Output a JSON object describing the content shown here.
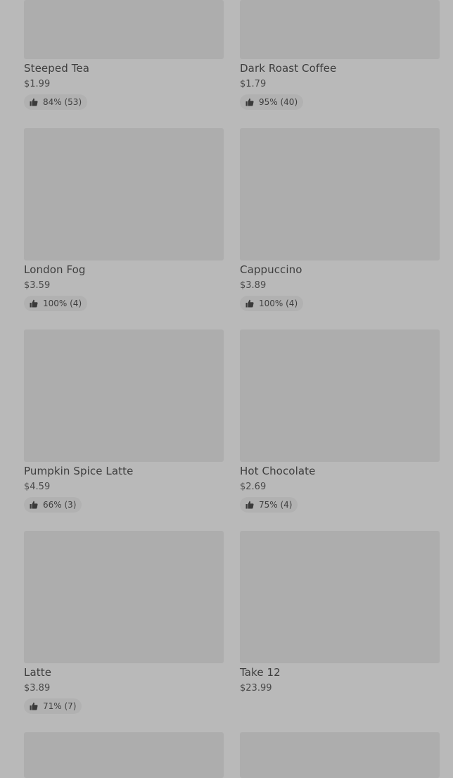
{
  "products": [
    {
      "name": "Steeped Tea",
      "price": "$1.99",
      "rating": "84% (53)"
    },
    {
      "name": "Dark Roast Coffee",
      "price": "$1.79",
      "rating": "95% (40)"
    },
    {
      "name": "London Fog",
      "price": "$3.59",
      "rating": "100% (4)"
    },
    {
      "name": "Cappuccino",
      "price": "$3.89",
      "rating": "100% (4)"
    },
    {
      "name": "Pumpkin Spice Latte",
      "price": "$4.59",
      "rating": "66% (3)"
    },
    {
      "name": "Hot Chocolate",
      "price": "$2.69",
      "rating": "75% (4)"
    },
    {
      "name": "Latte",
      "price": "$3.89",
      "rating": "71% (7)"
    },
    {
      "name": "Take 12",
      "price": "$23.99"
    },
    {},
    {}
  ],
  "icons": {
    "rating": "thumbs-up-icon"
  },
  "colors": {
    "overlay_background": "#b9b9b9",
    "thumbnail": "#adadad",
    "rating_pill": "#b1b1b1",
    "text": "#3e3e3e"
  }
}
